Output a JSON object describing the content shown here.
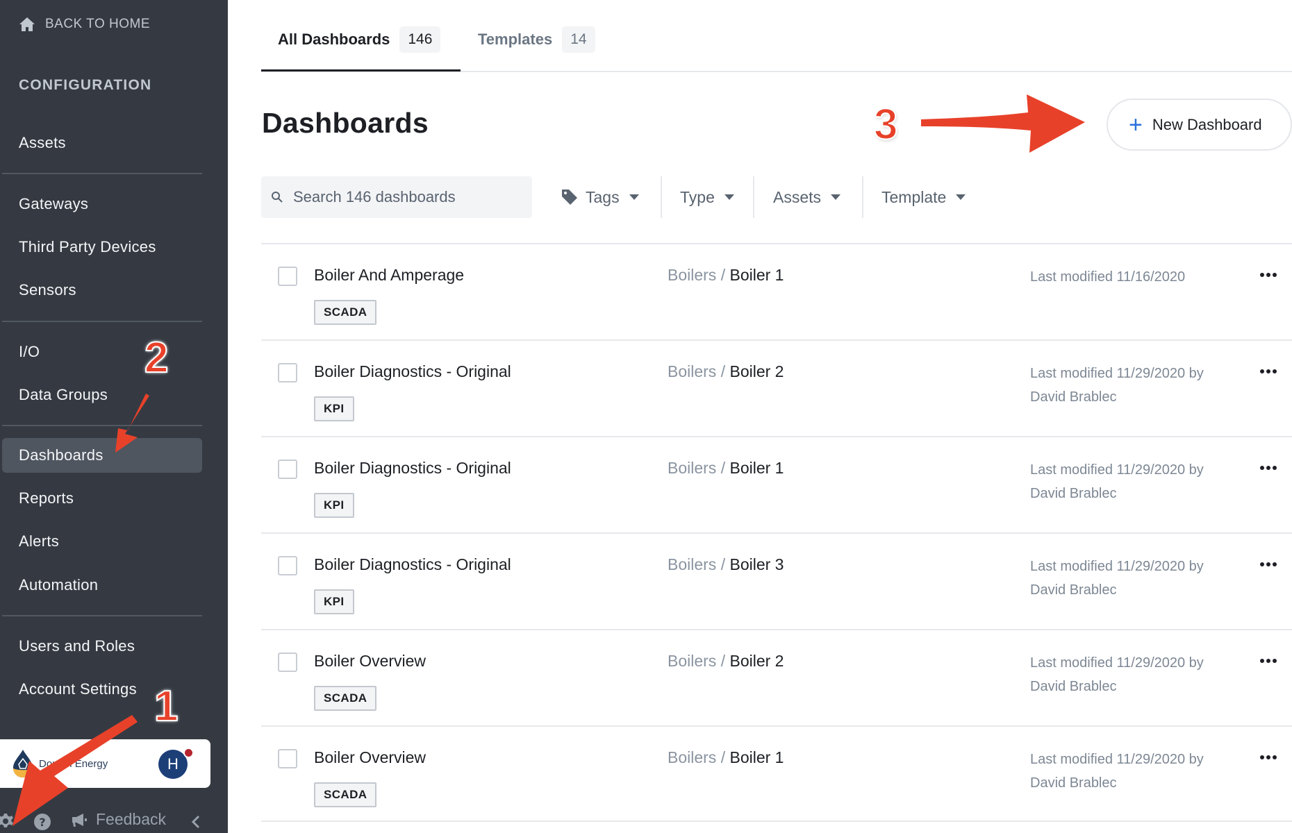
{
  "sidebar": {
    "back_home": "BACK TO HOME",
    "section_title": "CONFIGURATION",
    "items": [
      {
        "label": "Assets"
      },
      {
        "label": "Gateways"
      },
      {
        "label": "Third Party Devices"
      },
      {
        "label": "Sensors"
      },
      {
        "label": "I/O"
      },
      {
        "label": "Data Groups"
      },
      {
        "label": "Dashboards",
        "active": true
      },
      {
        "label": "Reports"
      },
      {
        "label": "Alerts"
      },
      {
        "label": "Automation"
      },
      {
        "label": "Users and Roles"
      },
      {
        "label": "Account Settings"
      }
    ],
    "org": {
      "name": "Donlon Energy",
      "avatar_initial": "H"
    },
    "feedback_label": "Feedback"
  },
  "tabs": [
    {
      "label": "All Dashboards",
      "count": "146",
      "active": true
    },
    {
      "label": "Templates",
      "count": "14",
      "active": false
    }
  ],
  "page": {
    "title": "Dashboards",
    "new_button_label": "New Dashboard"
  },
  "filters": {
    "search_placeholder": "Search 146 dashboards",
    "tags": "Tags",
    "type": "Type",
    "assets": "Assets",
    "template": "Template"
  },
  "dashboards": [
    {
      "name": "Boiler And Amperage",
      "tag": "SCADA",
      "asset_parent": "Boilers",
      "asset_child": "Boiler 1",
      "modified": "Last modified 11/16/2020"
    },
    {
      "name": "Boiler Diagnostics - Original",
      "tag": "KPI",
      "asset_parent": "Boilers",
      "asset_child": "Boiler 2",
      "modified": "Last modified 11/29/2020 by David Brablec"
    },
    {
      "name": "Boiler Diagnostics - Original",
      "tag": "KPI",
      "asset_parent": "Boilers",
      "asset_child": "Boiler 1",
      "modified": "Last modified 11/29/2020 by David Brablec"
    },
    {
      "name": "Boiler Diagnostics - Original",
      "tag": "KPI",
      "asset_parent": "Boilers",
      "asset_child": "Boiler 3",
      "modified": "Last modified 11/29/2020 by David Brablec"
    },
    {
      "name": "Boiler Overview",
      "tag": "SCADA",
      "asset_parent": "Boilers",
      "asset_child": "Boiler 2",
      "modified": "Last modified 11/29/2020 by David Brablec"
    },
    {
      "name": "Boiler Overview",
      "tag": "SCADA",
      "asset_parent": "Boilers",
      "asset_child": "Boiler 1",
      "modified": "Last modified 11/29/2020 by David Brablec"
    }
  ],
  "annotations": {
    "step1": "1",
    "step2": "2",
    "step3": "3"
  },
  "colors": {
    "sidebar_bg": "#353a42",
    "accent_blue": "#2a6fdb",
    "annotation_red": "#e8412a"
  }
}
